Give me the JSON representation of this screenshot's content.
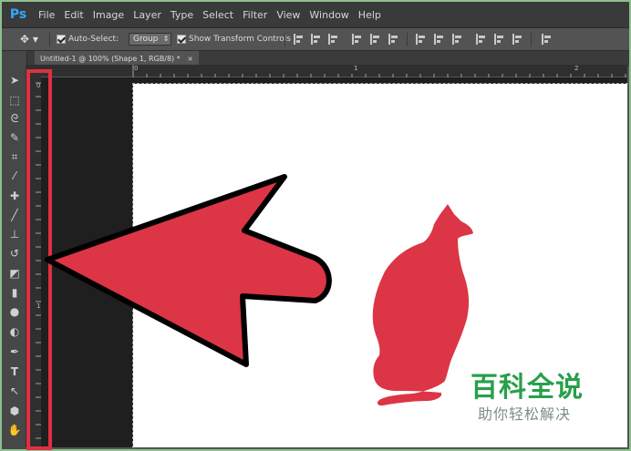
{
  "app": {
    "logo": "Ps",
    "menu": [
      "File",
      "Edit",
      "Image",
      "Layer",
      "Type",
      "Select",
      "Filter",
      "View",
      "Window",
      "Help"
    ]
  },
  "options": {
    "auto_select_label": "Auto-Select:",
    "auto_select_checked": true,
    "auto_select_mode": "Group",
    "show_transform_label": "Show Transform Controls",
    "show_transform_checked": true
  },
  "document": {
    "tab_title": "Untitled-1 @ 100% (Shape 1, RGB/8) *",
    "close_glyph": "×"
  },
  "rulers": {
    "h_labels": [
      "0",
      "1",
      "2"
    ],
    "v_labels": [
      "0",
      "1"
    ]
  },
  "tools": [
    "move-tool",
    "marquee-tool",
    "lasso-tool",
    "quick-select-tool",
    "crop-tool",
    "eyedropper-tool",
    "healing-brush-tool",
    "brush-tool",
    "clone-stamp-tool",
    "history-brush-tool",
    "eraser-tool",
    "gradient-tool",
    "blur-tool",
    "dodge-tool",
    "pen-tool",
    "type-tool",
    "path-select-tool",
    "shape-tool",
    "hand-tool"
  ],
  "colors": {
    "highlight": "#e03040",
    "shape": "#dc3545",
    "watermark_green": "#27a04a"
  },
  "watermark": {
    "title": "百科全说",
    "subtitle": "助你轻松解决"
  }
}
